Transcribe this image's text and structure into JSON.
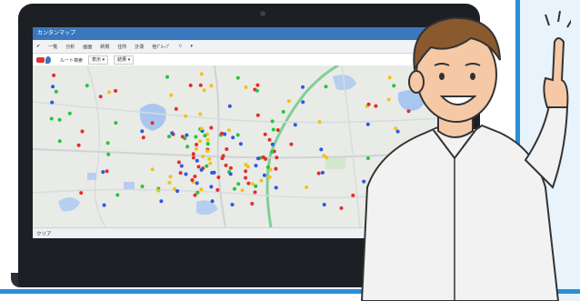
{
  "app": {
    "title": "カンタンマップ"
  },
  "toolbar": {
    "items": [
      "一覧",
      "分析",
      "画面",
      "新規",
      "住所",
      "計測",
      "他ｸﾞﾙｰﾌﾟ"
    ]
  },
  "search": {
    "route_label": "ルート検索",
    "option1": "表示",
    "option2": "結果"
  },
  "footer": {
    "clear_label": "クリア"
  },
  "colors": {
    "accent": "#2a8fd6",
    "titlebar": "#3a78bd",
    "marker_red": "#e22d2d",
    "marker_green": "#27c43a",
    "marker_blue": "#2b57e6",
    "marker_yellow": "#f2c318"
  },
  "icons": {
    "logo": "car-pin-icon",
    "checkmark": "check-icon",
    "person": "pointing-man-illustration"
  }
}
